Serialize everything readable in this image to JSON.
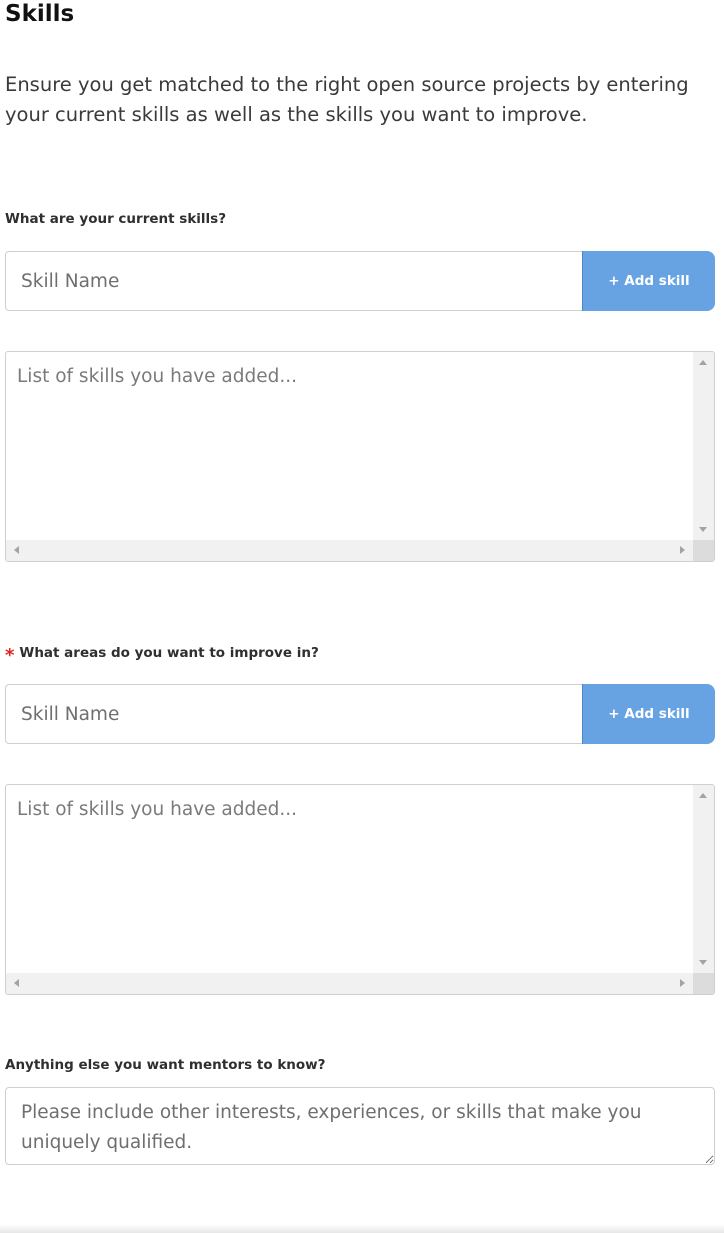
{
  "section": {
    "title": "Skills",
    "intro": "Ensure you get matched to the right open source projects by entering your current skills as well as the skills you want to improve."
  },
  "current_skills": {
    "label": "What are your current skills?",
    "input_placeholder": "Skill Name",
    "add_button_label": "+ Add skill",
    "list_placeholder": "List of skills you have added..."
  },
  "improve_skills": {
    "required_marker": "*",
    "label": "What areas do you want to improve in?",
    "input_placeholder": "Skill Name",
    "add_button_label": "+ Add skill",
    "list_placeholder": "List of skills you have added..."
  },
  "mentor_notes": {
    "label": "Anything else you want mentors to know?",
    "placeholder": "Please include other interests, experiences, or skills that make you uniquely qualified."
  },
  "colors": {
    "accent_button": "#67a3e3",
    "required": "#e02424"
  }
}
